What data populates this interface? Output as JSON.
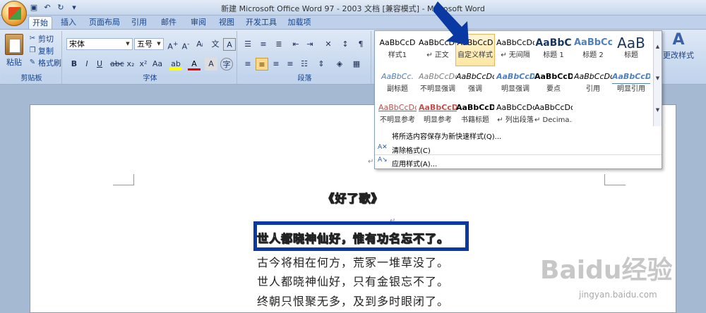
{
  "window": {
    "title": "新建 Microsoft Office Word 97 - 2003 文档 [兼容模式] - Microsoft Word"
  },
  "tabs": [
    {
      "label": "开始"
    },
    {
      "label": "插入"
    },
    {
      "label": "页面布局"
    },
    {
      "label": "引用"
    },
    {
      "label": "邮件"
    },
    {
      "label": "审阅"
    },
    {
      "label": "视图"
    },
    {
      "label": "开发工具"
    },
    {
      "label": "加载项"
    }
  ],
  "clipboard": {
    "paste": "粘贴",
    "cut": "剪切",
    "copy": "复制",
    "painter": "格式刷",
    "group": "剪贴板"
  },
  "font": {
    "name": "宋体",
    "size": "五号",
    "group": "字体"
  },
  "paragraph": {
    "group": "段落"
  },
  "styles_gallery": [
    {
      "preview": "AaBbCcD",
      "name": "样式1"
    },
    {
      "preview": "AaBbCcDc",
      "name": "↵ 正文"
    },
    {
      "preview": "AaBbCcD",
      "name": "自定义样式"
    },
    {
      "preview": "AaBbCcDc",
      "name": "↵ 无间隔"
    },
    {
      "preview": "AaBbC",
      "name": "标题 1"
    },
    {
      "preview": "AaBbCc",
      "name": "标题 2"
    },
    {
      "preview": "AaB",
      "name": "标题"
    },
    {
      "preview": "AaBbCc.",
      "name": "副标题"
    },
    {
      "preview": "AaBbCcDc",
      "name": "不明显强调"
    },
    {
      "preview": "AaBbCcDc",
      "name": "强调"
    },
    {
      "preview": "AaBbCcDc",
      "name": "明显强调"
    },
    {
      "preview": "AaBbCcDc",
      "name": "要点"
    },
    {
      "preview": "AaBbCcDc",
      "name": "引用"
    },
    {
      "preview": "AaBbCcDc",
      "name": "明显引用"
    },
    {
      "preview": "AaBbCcDc",
      "name": "不明显参考"
    },
    {
      "preview": "AaBbCcDc",
      "name": "明显参考"
    },
    {
      "preview": "AaBbCcDc",
      "name": "书籍标题"
    },
    {
      "preview": "AaBbCcDc",
      "name": "↵ 列出段落"
    },
    {
      "preview": "AaBbCcDc",
      "name": "↵ Decima..."
    }
  ],
  "styles_menu": {
    "save": "将所选内容保存为新快速样式(Q)...",
    "clear": "清除格式(C)",
    "apply": "应用样式(A)..."
  },
  "change_styles": "更改样式",
  "document": {
    "title": "《好了歌》",
    "lines": [
      "世人都晓神仙好，惟有功名忘不了。",
      "古今将相在何方，荒冢一堆草没了。",
      "世人都晓神仙好，只有金银忘不了。",
      "终朝只恨聚无多，及到多时眼闭了。"
    ]
  },
  "watermark": {
    "text": "Baidu经验",
    "url": "jingyan.baidu.com"
  }
}
